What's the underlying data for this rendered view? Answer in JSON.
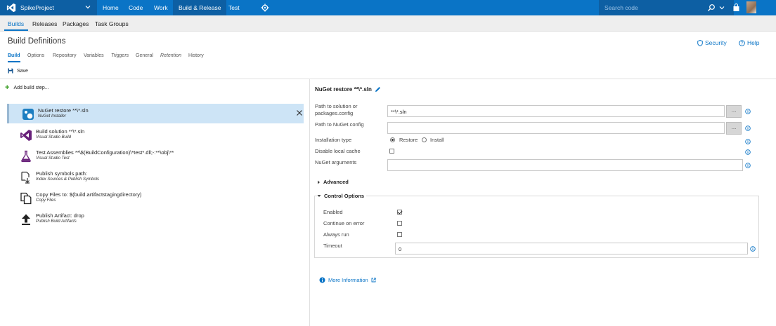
{
  "topbar": {
    "project": "SpikeProject",
    "nav": [
      "Home",
      "Code",
      "Work",
      "Build & Release",
      "Test"
    ],
    "active_nav": "Build & Release",
    "search_placeholder": "Search code",
    "brand_color": "#0a74c6"
  },
  "hub": {
    "items": [
      "Builds",
      "Releases",
      "Packages",
      "Task Groups"
    ],
    "active": "Builds"
  },
  "page": {
    "title": "Build Definitions",
    "security": "Security",
    "help": "Help",
    "subtabs": [
      "Build",
      "Options",
      "Repository",
      "Variables",
      "Triggers",
      "General",
      "Retention",
      "History"
    ],
    "active_subtab": "Build",
    "save": "Save"
  },
  "steps_pane": {
    "add_step": "Add build step...",
    "steps": [
      {
        "title": "NuGet restore **\\*.sln",
        "subtitle": "NuGet Installer",
        "icon": "nuget-icon",
        "selected": true
      },
      {
        "title": "Build solution **\\*.sln",
        "subtitle": "Visual Studio Build",
        "icon": "visual-studio-icon"
      },
      {
        "title": "Test Assemblies **\\$(BuildConfiguration)\\*test*.dll;-:**\\obj\\**",
        "subtitle": "Visual Studio Test",
        "icon": "test-flask-icon"
      },
      {
        "title": "Publish symbols path:",
        "subtitle": "Index Sources & Publish Symbols",
        "icon": "publish-symbols-icon"
      },
      {
        "title": "Copy Files to: $(build.artifactstagingdirectory)",
        "subtitle": "Copy Files",
        "icon": "copy-files-icon"
      },
      {
        "title": "Publish Artifact: drop",
        "subtitle": "Publish Build Artifacts",
        "icon": "upload-icon"
      }
    ]
  },
  "task": {
    "title": "NuGet restore **\\*.sln",
    "fields": {
      "solution_label_line1": "Path to solution or",
      "solution_label_line2": "packages.config",
      "solution_value": "**\\*.sln",
      "nuget_config_label": "Path to NuGet.config",
      "nuget_config_value": "",
      "installation_type_label": "Installation type",
      "restore_label": "Restore",
      "install_label": "Install",
      "installation_type_selected": "Restore",
      "disable_cache_label": "Disable local cache",
      "disable_cache_checked": false,
      "nuget_args_label": "NuGet arguments",
      "nuget_args_value": ""
    },
    "browse_label": "...",
    "advanced": "Advanced",
    "control_options": {
      "title": "Control Options",
      "enabled_label": "Enabled",
      "enabled": true,
      "continue_on_error_label": "Continue on error",
      "continue_on_error": false,
      "always_run_label": "Always run",
      "always_run": false,
      "timeout_label": "Timeout",
      "timeout_value": "0"
    },
    "more_info": "More Information"
  }
}
